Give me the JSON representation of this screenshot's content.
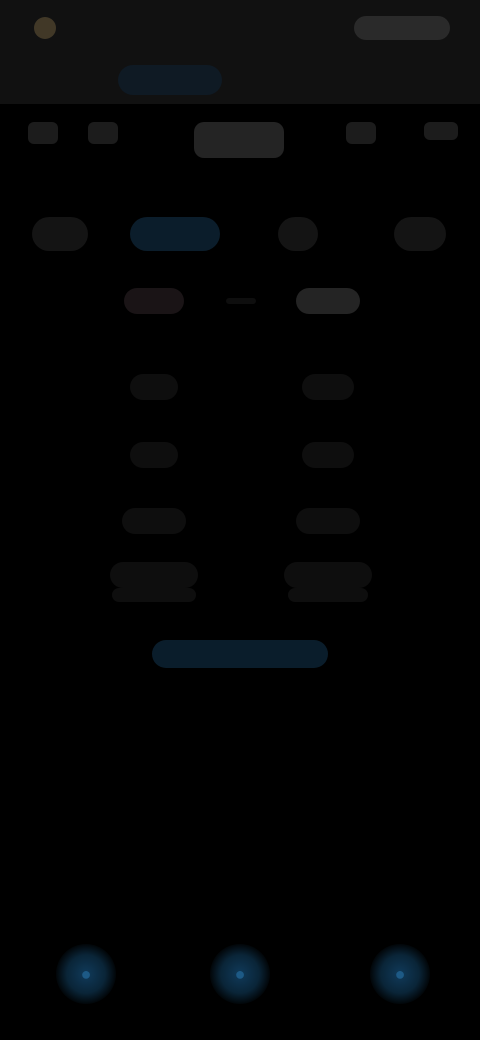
{
  "header": {
    "app_name": "",
    "action_label": "",
    "modes": [
      {
        "label": ""
      },
      {
        "label": ""
      }
    ]
  },
  "categories": [
    {
      "label": ""
    },
    {
      "label": ""
    },
    {
      "label": ""
    },
    {
      "label": ""
    }
  ],
  "chips": [
    {
      "label": ""
    },
    {
      "label": ""
    },
    {
      "label": ""
    },
    {
      "label": ""
    }
  ],
  "columns": {
    "left_header": "",
    "right_header": "",
    "left_cells": [
      "",
      "",
      "",
      "",
      ""
    ],
    "right_cells": [
      "",
      "",
      "",
      "",
      ""
    ]
  },
  "primary_action": {
    "label": ""
  },
  "bottom_nav": {
    "items": [
      {
        "icon": "circle-icon"
      },
      {
        "icon": "circle-icon"
      },
      {
        "icon": "circle-icon"
      }
    ]
  },
  "colors": {
    "background": "#000000",
    "header": "#111111",
    "accent": "#1d5a86"
  }
}
